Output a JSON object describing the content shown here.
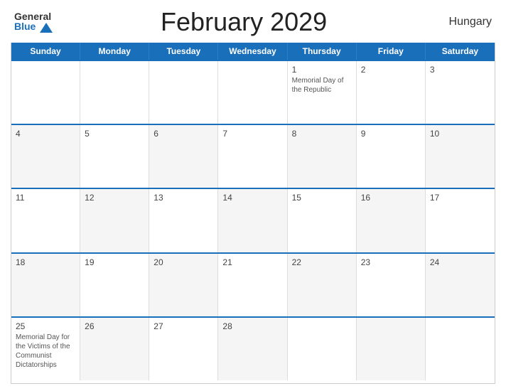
{
  "header": {
    "logo_general": "General",
    "logo_blue": "Blue",
    "title": "February 2029",
    "country": "Hungary"
  },
  "days_of_week": [
    "Sunday",
    "Monday",
    "Tuesday",
    "Wednesday",
    "Thursday",
    "Friday",
    "Saturday"
  ],
  "weeks": [
    [
      {
        "day": "",
        "event": "",
        "alt": false
      },
      {
        "day": "",
        "event": "",
        "alt": false
      },
      {
        "day": "",
        "event": "",
        "alt": false
      },
      {
        "day": "",
        "event": "",
        "alt": false
      },
      {
        "day": "1",
        "event": "Memorial Day of the Republic",
        "alt": false
      },
      {
        "day": "2",
        "event": "",
        "alt": false
      },
      {
        "day": "3",
        "event": "",
        "alt": false
      }
    ],
    [
      {
        "day": "4",
        "event": "",
        "alt": true
      },
      {
        "day": "5",
        "event": "",
        "alt": false
      },
      {
        "day": "6",
        "event": "",
        "alt": true
      },
      {
        "day": "7",
        "event": "",
        "alt": false
      },
      {
        "day": "8",
        "event": "",
        "alt": true
      },
      {
        "day": "9",
        "event": "",
        "alt": false
      },
      {
        "day": "10",
        "event": "",
        "alt": true
      }
    ],
    [
      {
        "day": "11",
        "event": "",
        "alt": false
      },
      {
        "day": "12",
        "event": "",
        "alt": true
      },
      {
        "day": "13",
        "event": "",
        "alt": false
      },
      {
        "day": "14",
        "event": "",
        "alt": true
      },
      {
        "day": "15",
        "event": "",
        "alt": false
      },
      {
        "day": "16",
        "event": "",
        "alt": true
      },
      {
        "day": "17",
        "event": "",
        "alt": false
      }
    ],
    [
      {
        "day": "18",
        "event": "",
        "alt": true
      },
      {
        "day": "19",
        "event": "",
        "alt": false
      },
      {
        "day": "20",
        "event": "",
        "alt": true
      },
      {
        "day": "21",
        "event": "",
        "alt": false
      },
      {
        "day": "22",
        "event": "",
        "alt": true
      },
      {
        "day": "23",
        "event": "",
        "alt": false
      },
      {
        "day": "24",
        "event": "",
        "alt": true
      }
    ],
    [
      {
        "day": "25",
        "event": "Memorial Day for the Victims of the Communist Dictatorships",
        "alt": false
      },
      {
        "day": "26",
        "event": "",
        "alt": true
      },
      {
        "day": "27",
        "event": "",
        "alt": false
      },
      {
        "day": "28",
        "event": "",
        "alt": true
      },
      {
        "day": "",
        "event": "",
        "alt": false
      },
      {
        "day": "",
        "event": "",
        "alt": true
      },
      {
        "day": "",
        "event": "",
        "alt": false
      }
    ]
  ]
}
